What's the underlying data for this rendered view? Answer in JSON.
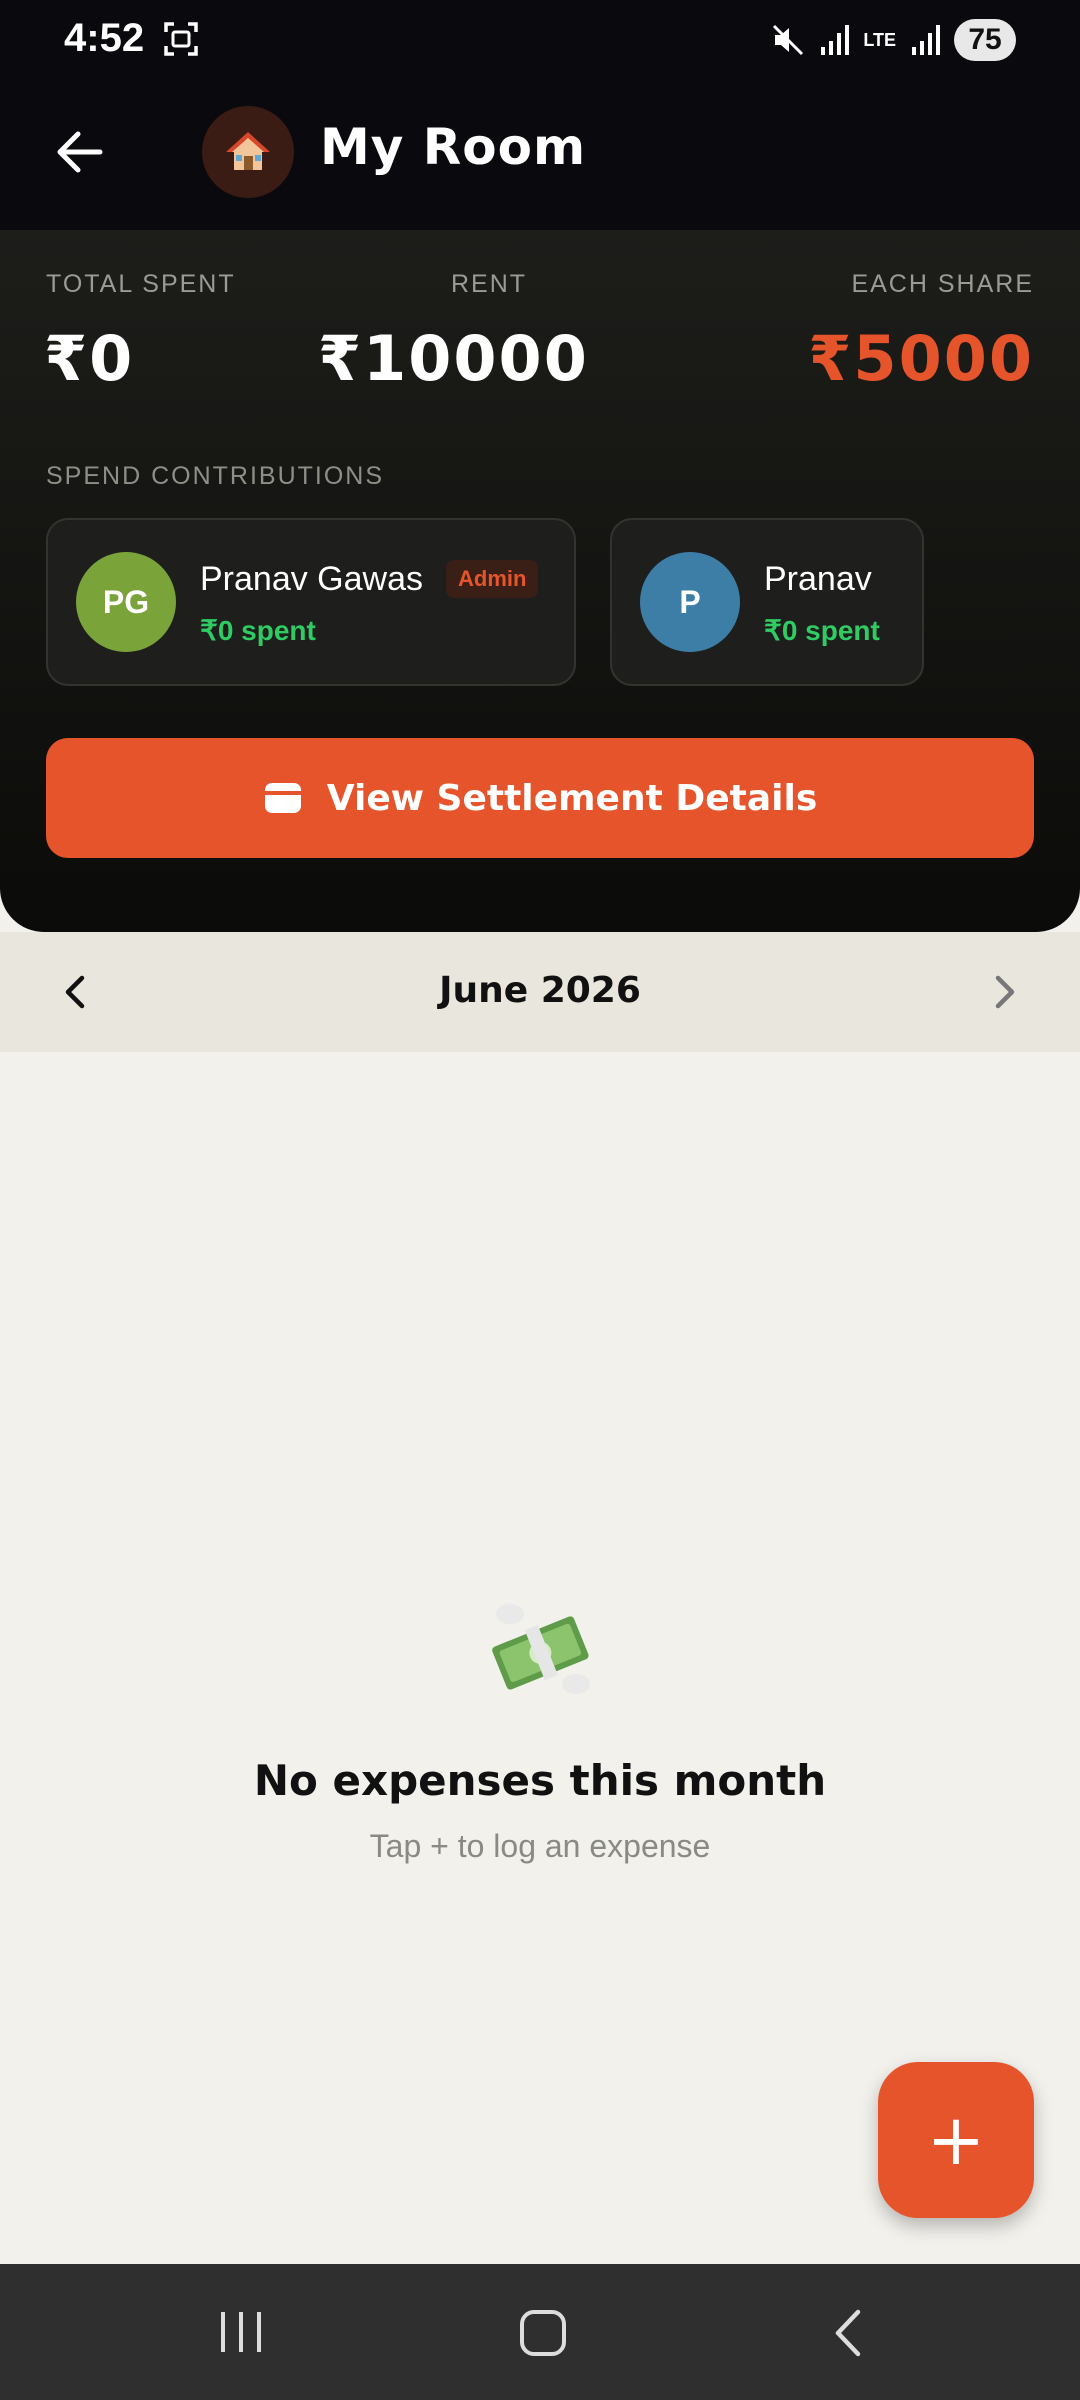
{
  "status_bar": {
    "time": "4:52",
    "network": "LTE",
    "battery": "75"
  },
  "header": {
    "title": "My Room",
    "room_icon": "house-emoji"
  },
  "summary": {
    "total_spent_label": "TOTAL SPENT",
    "total_spent_value": "₹0",
    "rent_label": "RENT",
    "rent_value": "₹10000",
    "each_share_label": "EACH SHARE",
    "each_share_value": "₹5000",
    "section_label": "SPEND CONTRIBUTIONS"
  },
  "members": [
    {
      "initials": "PG",
      "name": "Pranav Gawas",
      "badge": "Admin",
      "spent": "₹0 spent",
      "avatar_color": "#7aa33a"
    },
    {
      "initials": "P",
      "name": "Pranav",
      "spent": "₹0 spent",
      "avatar_color": "#3d7ea6"
    }
  ],
  "settlement_button": {
    "label": "View Settlement Details"
  },
  "month_nav": {
    "label": "June 2026"
  },
  "empty_state": {
    "title": "No expenses this month",
    "subtitle": "Tap + to log an expense"
  },
  "fab": {
    "label": "+"
  },
  "colors": {
    "accent": "#e5542a",
    "positive": "#2ecc62",
    "dark_bg": "#0a0a0e",
    "light_bg": "#f2f1ec"
  }
}
